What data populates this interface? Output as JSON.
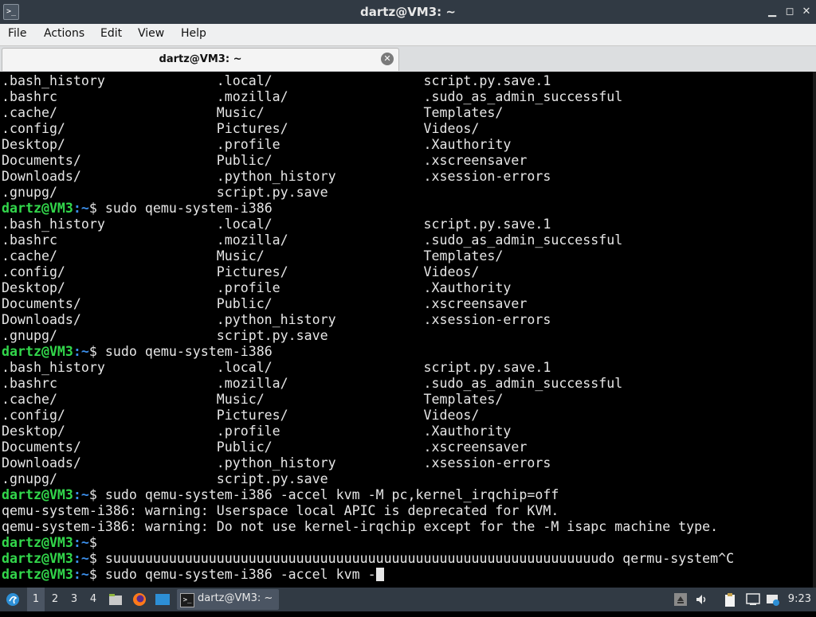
{
  "window": {
    "title": "dartz@VM3: ~",
    "app_icon": "terminal-icon",
    "buttons": [
      "minimize-icon",
      "maximize-icon",
      "close-icon"
    ]
  },
  "menu": [
    "File",
    "Actions",
    "Edit",
    "View",
    "Help"
  ],
  "tab": {
    "label": "dartz@VM3: ~",
    "close_icon": "close-circle-icon"
  },
  "terminal": {
    "prompt_user": "dartz@VM3",
    "prompt_path": "~",
    "lines": [
      {
        "t": ".bash_history              .local/                   script.py.save.1"
      },
      {
        "t": ".bashrc                    .mozilla/                 .sudo_as_admin_successful"
      },
      {
        "t": ".cache/                    Music/                    Templates/"
      },
      {
        "t": ".config/                   Pictures/                 Videos/"
      },
      {
        "t": "Desktop/                   .profile                  .Xauthority"
      },
      {
        "t": "Documents/                 Public/                   .xscreensaver"
      },
      {
        "t": "Downloads/                 .python_history           .xsession-errors"
      },
      {
        "t": ".gnupg/                    script.py.save"
      },
      {
        "p": true,
        "t": "sudo qemu-system-i386"
      },
      {
        "t": ".bash_history              .local/                   script.py.save.1"
      },
      {
        "t": ".bashrc                    .mozilla/                 .sudo_as_admin_successful"
      },
      {
        "t": ".cache/                    Music/                    Templates/"
      },
      {
        "t": ".config/                   Pictures/                 Videos/"
      },
      {
        "t": "Desktop/                   .profile                  .Xauthority"
      },
      {
        "t": "Documents/                 Public/                   .xscreensaver"
      },
      {
        "t": "Downloads/                 .python_history           .xsession-errors"
      },
      {
        "t": ".gnupg/                    script.py.save"
      },
      {
        "p": true,
        "t": "sudo qemu-system-i386"
      },
      {
        "t": ".bash_history              .local/                   script.py.save.1"
      },
      {
        "t": ".bashrc                    .mozilla/                 .sudo_as_admin_successful"
      },
      {
        "t": ".cache/                    Music/                    Templates/"
      },
      {
        "t": ".config/                   Pictures/                 Videos/"
      },
      {
        "t": "Desktop/                   .profile                  .Xauthority"
      },
      {
        "t": "Documents/                 Public/                   .xscreensaver"
      },
      {
        "t": "Downloads/                 .python_history           .xsession-errors"
      },
      {
        "t": ".gnupg/                    script.py.save"
      },
      {
        "p": true,
        "t": "sudo qemu-system-i386 -accel kvm -M pc,kernel_irqchip=off"
      },
      {
        "t": "qemu-system-i386: warning: Userspace local APIC is deprecated for KVM."
      },
      {
        "t": "qemu-system-i386: warning: Do not use kernel-irqchip except for the -M isapc machine type."
      },
      {
        "p": true,
        "t": ""
      },
      {
        "p": true,
        "t": "suuuuuuuuuuuuuuuuuuuuuuuuuuuuuuuuuuuuuuuuuuuuuuuuuuuuuuuuuuuuudo qermu-system^C"
      },
      {
        "p": true,
        "t": "sudo qemu-system-i386 -accel kvm -",
        "cursor": true
      }
    ]
  },
  "taskbar": {
    "start_icon": "lxqt-start-icon",
    "workspaces": [
      "1",
      "2",
      "3",
      "4"
    ],
    "active_workspace": "1",
    "launchers": [
      "file-manager-icon",
      "firefox-icon",
      "desktop-icon"
    ],
    "task_label": "dartz@VM3: ~",
    "tray": [
      "eject-icon",
      "volume-icon",
      "clipboard-icon",
      "network-icon",
      "update-notifier-icon"
    ],
    "clock": "9:23"
  },
  "colors": {
    "prompt_user": "#32d74b",
    "prompt_path": "#3b8eea",
    "panel": "#313a44",
    "terminal_bg": "#000000"
  }
}
